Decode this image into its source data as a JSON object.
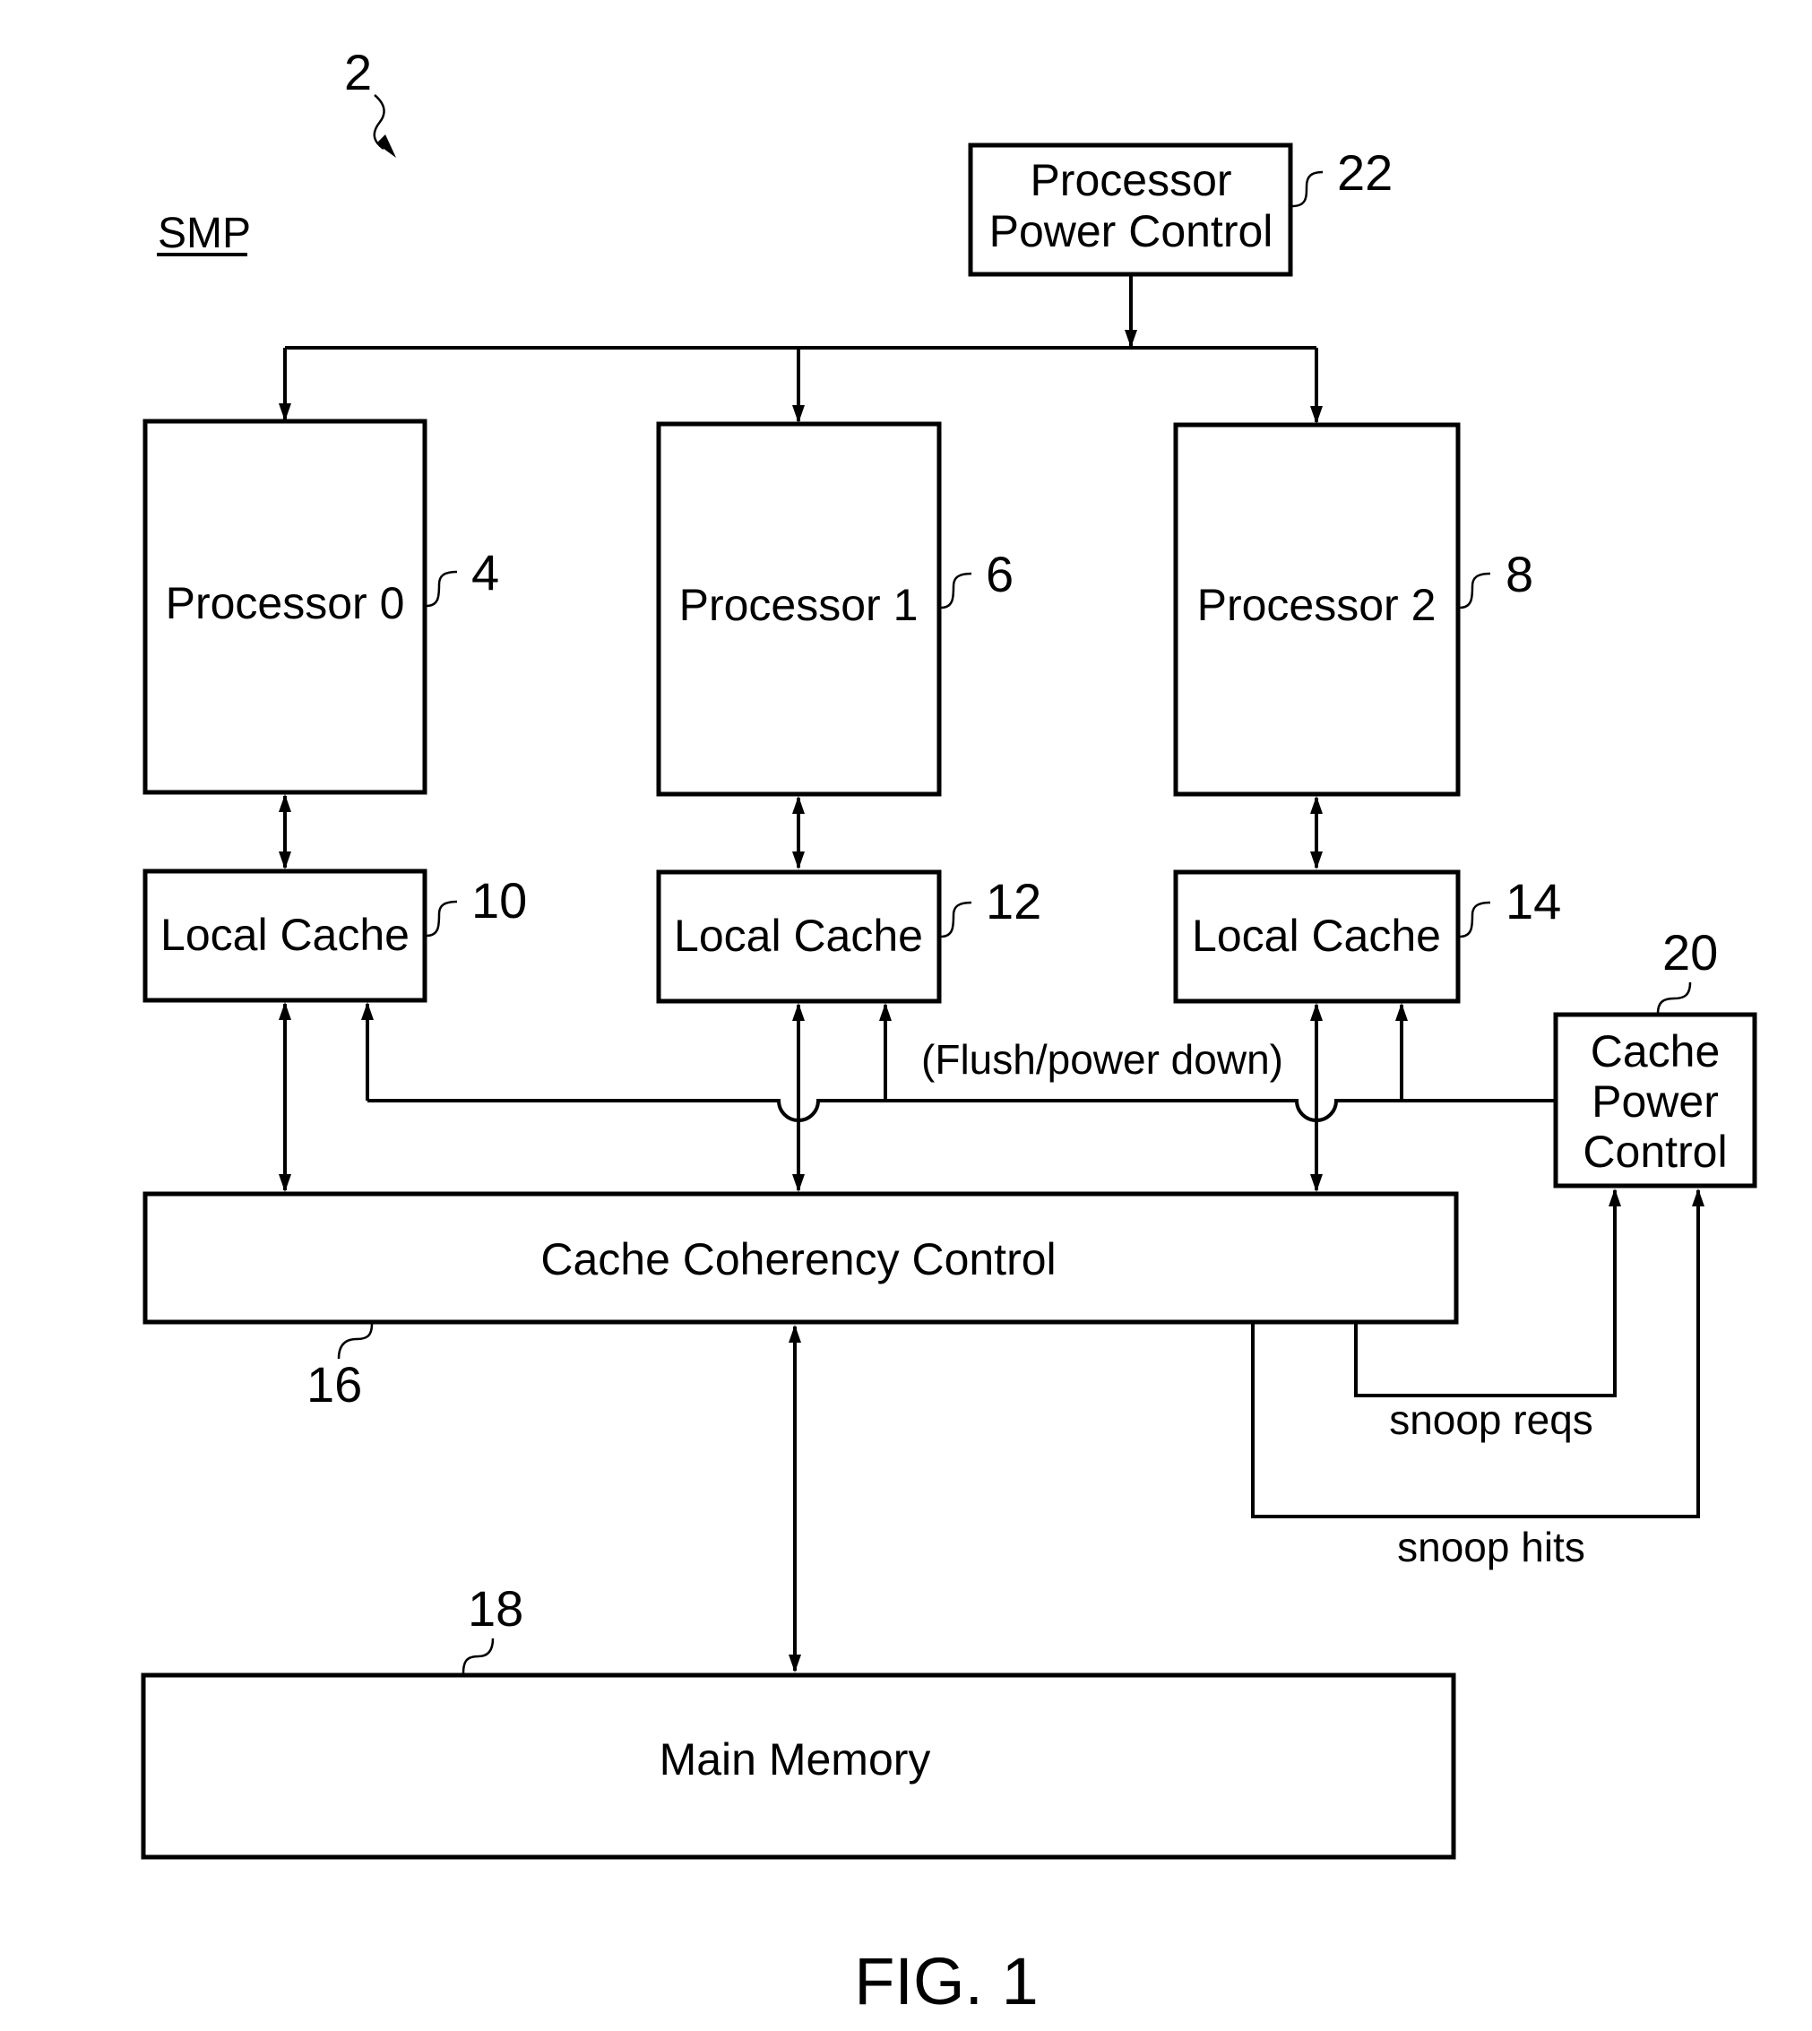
{
  "figure": {
    "system_ref": "2",
    "system_label": "SMP",
    "caption": "FIG. 1"
  },
  "blocks": {
    "processor_power_control": {
      "line1": "Processor",
      "line2": "Power Control",
      "ref": "22"
    },
    "processors": [
      {
        "label": "Processor 0",
        "ref": "4"
      },
      {
        "label": "Processor 1",
        "ref": "6"
      },
      {
        "label": "Processor 2",
        "ref": "8"
      }
    ],
    "local_caches": [
      {
        "label": "Local Cache",
        "ref": "10"
      },
      {
        "label": "Local Cache",
        "ref": "12"
      },
      {
        "label": "Local Cache",
        "ref": "14"
      }
    ],
    "cache_power_control": {
      "line1": "Cache",
      "line2": "Power",
      "line3": "Control",
      "ref": "20"
    },
    "cache_coherency_control": {
      "label": "Cache Coherency Control",
      "ref": "16"
    },
    "main_memory": {
      "label": "Main Memory",
      "ref": "18"
    }
  },
  "signals": {
    "flush": "(Flush/power down)",
    "snoop_reqs": "snoop reqs",
    "snoop_hits": "snoop hits"
  },
  "colors": {
    "ink": "#000000",
    "paper": "#ffffff"
  }
}
